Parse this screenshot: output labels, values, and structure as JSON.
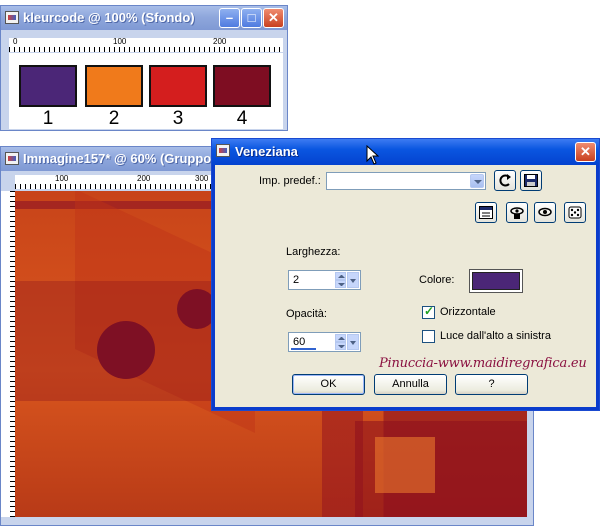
{
  "palette_window": {
    "title": "kleurcode @ 100% (Sfondo)",
    "ruler_labels": [
      "0",
      "100",
      "200"
    ],
    "swatches": [
      {
        "number": "1",
        "color": "#4b2677"
      },
      {
        "number": "2",
        "color": "#f07a1b"
      },
      {
        "number": "3",
        "color": "#d41e1e"
      },
      {
        "number": "4",
        "color": "#7e0d22"
      }
    ]
  },
  "image_window": {
    "title": "Immagine157* @  60% (Gruppo",
    "ruler_labels": [
      "100",
      "200",
      "300"
    ]
  },
  "dialog": {
    "title": "Veneziana",
    "preset_label": "Imp. predef.:",
    "preset_value": "",
    "width_label": "Larghezza:",
    "width_value": "2",
    "opacity_label": "Opacità:",
    "opacity_value": "60",
    "color_label": "Colore:",
    "color_value": "#4b2677",
    "horizontal_label": "Orizzontale",
    "horizontal_checked": true,
    "light_label": "Luce dall'alto a sinistra",
    "light_checked": false,
    "ok_label": "OK",
    "cancel_label": "Annulla",
    "help_label": "?",
    "watermark": "Pinuccia-www.maidiregrafica.eu"
  },
  "icons": {
    "preset_reset": "reset-arrow-icon",
    "preset_save": "save-disk-icon",
    "preview_toggle": "preview-window-icon",
    "proof": "eye-lock-icon",
    "auto_proof": "eye-icon",
    "randomize": "dice-icon"
  }
}
